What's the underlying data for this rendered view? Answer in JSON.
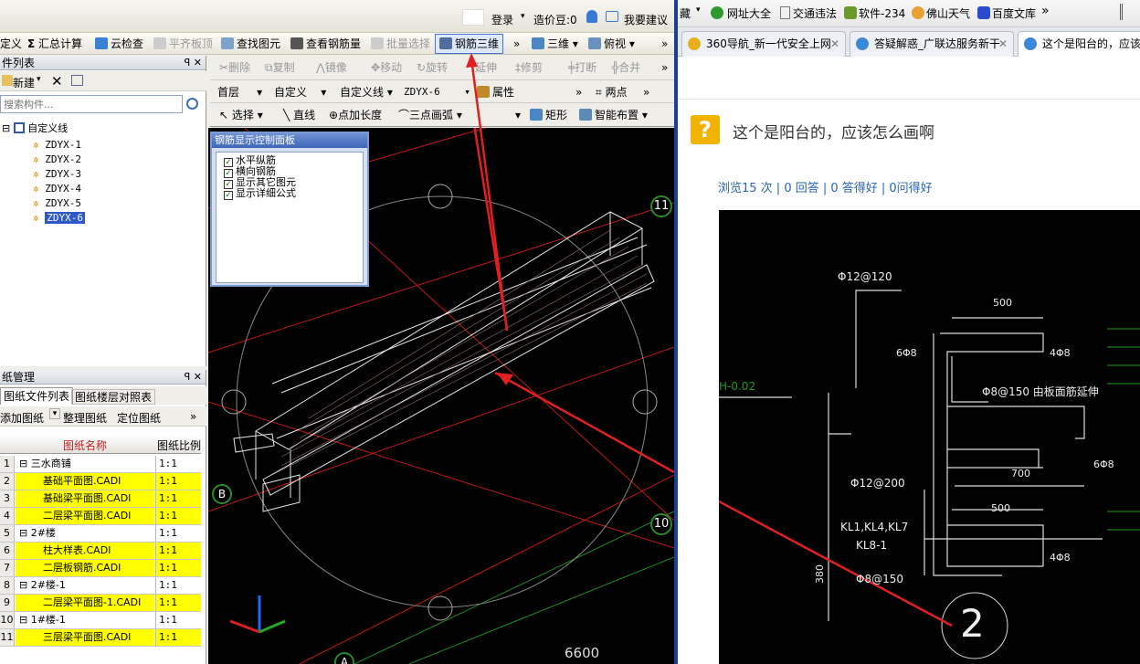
{
  "top": {
    "login": "登录",
    "price": "造价豆:0",
    "suggest": "我要建议"
  },
  "toolbar1": {
    "define": "定义",
    "sum": "汇总计算",
    "cloud": "云检查",
    "flat": "平齐板顶",
    "find": "查找图元",
    "view_rebar": "查看钢筋量",
    "batch": "批量选择",
    "rebar3d": "钢筋三维",
    "more": "»",
    "threed": "三维",
    "topview": "俯视",
    "more2": "»"
  },
  "toolbar2": {
    "delete": "删除",
    "copy": "复制",
    "mirror": "镜像",
    "move": "移动",
    "rotate": "旋转",
    "extend": "延伸",
    "trim": "修剪",
    "break": "打断",
    "merge": "合并",
    "more": "»"
  },
  "toolbar3": {
    "floor": "首层",
    "type": "自定义",
    "line": "自定义线",
    "item": "ZDYX-6",
    "prop": "属性",
    "twopoint": "两点",
    "more": "»"
  },
  "toolbar4": {
    "select": "选择",
    "straight": "直线",
    "addlen": "点加长度",
    "arc": "三点画弧",
    "rect": "矩形",
    "smart": "智能布置"
  },
  "comp_panel": {
    "title": "件列表",
    "new": "新建",
    "search_placeholder": "搜索构件...",
    "root": "自定义线",
    "items": [
      "ZDYX-1",
      "ZDYX-2",
      "ZDYX-3",
      "ZDYX-4",
      "ZDYX-5",
      "ZDYX-6"
    ]
  },
  "rebar_panel": {
    "title": "钢筋显示控制面板",
    "options": [
      "水平纵筋",
      "横向钢筋",
      "显示其它图元",
      "显示详细公式"
    ]
  },
  "drawing_panel": {
    "title": "纸管理",
    "tab1": "图纸文件列表",
    "tab2": "图纸楼层对照表",
    "add": "添加图纸",
    "organize": "整理图纸",
    "locate": "定位图纸",
    "col_name": "图纸名称",
    "col_scale": "图纸比例",
    "rows": [
      {
        "n": "1",
        "name": "三水商铺",
        "scale": "1:1",
        "group": true
      },
      {
        "n": "2",
        "name": "基础平面图.CADI",
        "scale": "1:1",
        "group": false
      },
      {
        "n": "3",
        "name": "基础梁平面图.CADI",
        "scale": "1:1",
        "group": false
      },
      {
        "n": "4",
        "name": "二层梁平面图.CADI",
        "scale": "1:1",
        "group": false
      },
      {
        "n": "5",
        "name": "2#楼",
        "scale": "1:1",
        "group": true
      },
      {
        "n": "6",
        "name": "柱大样表.CADI",
        "scale": "1:1",
        "group": false
      },
      {
        "n": "7",
        "name": "二层板钢筋.CADI",
        "scale": "1:1",
        "group": false
      },
      {
        "n": "8",
        "name": "2#楼-1",
        "scale": "1:1",
        "group": true
      },
      {
        "n": "9",
        "name": "二层梁平面图-1.CADI",
        "scale": "1:1",
        "group": false
      },
      {
        "n": "10",
        "name": "1#楼-1",
        "scale": "1:1",
        "group": true
      },
      {
        "n": "11",
        "name": "三层梁平面图.CADI",
        "scale": "1:1",
        "group": false
      }
    ]
  },
  "canvas": {
    "axis_11": "11",
    "axis_10": "10",
    "axis_b": "B",
    "axis_a": "A",
    "dim": "6600"
  },
  "browser": {
    "bookmarks": [
      "藏",
      "网址大全",
      "交通违法",
      "软件-234",
      "佛山天气",
      "百度文库"
    ],
    "tabs": [
      "360导航_新一代安全上网",
      "答疑解惑_广联达服务新干",
      "这个是阳台的，应该"
    ],
    "question": "这个是阳台的，应该怎么画啊",
    "stats": "浏览15 次 | 0 回答 | 0 答得好 | 0问得好"
  },
  "cad_labels": {
    "l1": "Φ12@120",
    "l2": "500",
    "l3": "6Φ8",
    "l4": "4Φ8",
    "l5": "Φ8@150 由板面筋延伸",
    "l6": "H-0.02",
    "l7": "Φ12@200",
    "l8": "700",
    "l9": "6Φ8",
    "l10": "500",
    "l11": "KL1,KL4,KL7",
    "l12": "KL8-1",
    "l13": "Φ8@150",
    "l14": "4Φ8",
    "l15": "380",
    "l16": "2"
  }
}
